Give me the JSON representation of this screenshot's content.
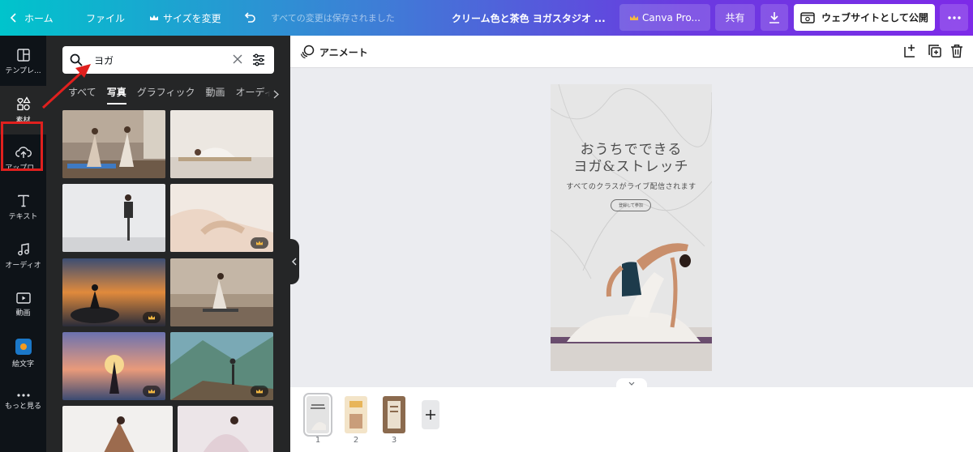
{
  "topbar": {
    "home_label": "ホーム",
    "file_label": "ファイル",
    "resize_label": "サイズを変更",
    "save_status": "すべての変更は保存されました",
    "doc_title": "クリーム色と茶色 ヨガスタジオ ...",
    "pro_label": "Canva Pro...",
    "share_label": "共有",
    "publish_label": "ウェブサイトとして公開"
  },
  "rail": {
    "items": [
      {
        "label": "テンプレ...",
        "icon": "template-icon"
      },
      {
        "label": "素材",
        "icon": "elements-icon"
      },
      {
        "label": "アップロ...",
        "icon": "upload-icon"
      },
      {
        "label": "テキスト",
        "icon": "text-icon"
      },
      {
        "label": "オーディオ",
        "icon": "music-icon"
      },
      {
        "label": "動画",
        "icon": "video-icon"
      },
      {
        "label": "絵文字",
        "icon": "emoji-icon"
      },
      {
        "label": "もっと見る",
        "icon": "more-icon"
      }
    ]
  },
  "panel": {
    "search_value": "ヨガ",
    "tabs": [
      "すべて",
      "写真",
      "グラフィック",
      "動画",
      "オーディオ"
    ],
    "active_tab": "写真"
  },
  "canvas": {
    "animate_label": "アニメート",
    "design": {
      "title_line1": "おうちでできる",
      "title_line2": "ヨガ&ストレッチ",
      "subtitle": "すべてのクラスがライブ配信されます",
      "button_text": "登録して参加"
    }
  },
  "pages": {
    "numbers": [
      "1",
      "2",
      "3"
    ]
  },
  "colors": {
    "highlight": "#e0201e",
    "rail_bg": "#0e1318",
    "panel_bg": "#252627"
  }
}
